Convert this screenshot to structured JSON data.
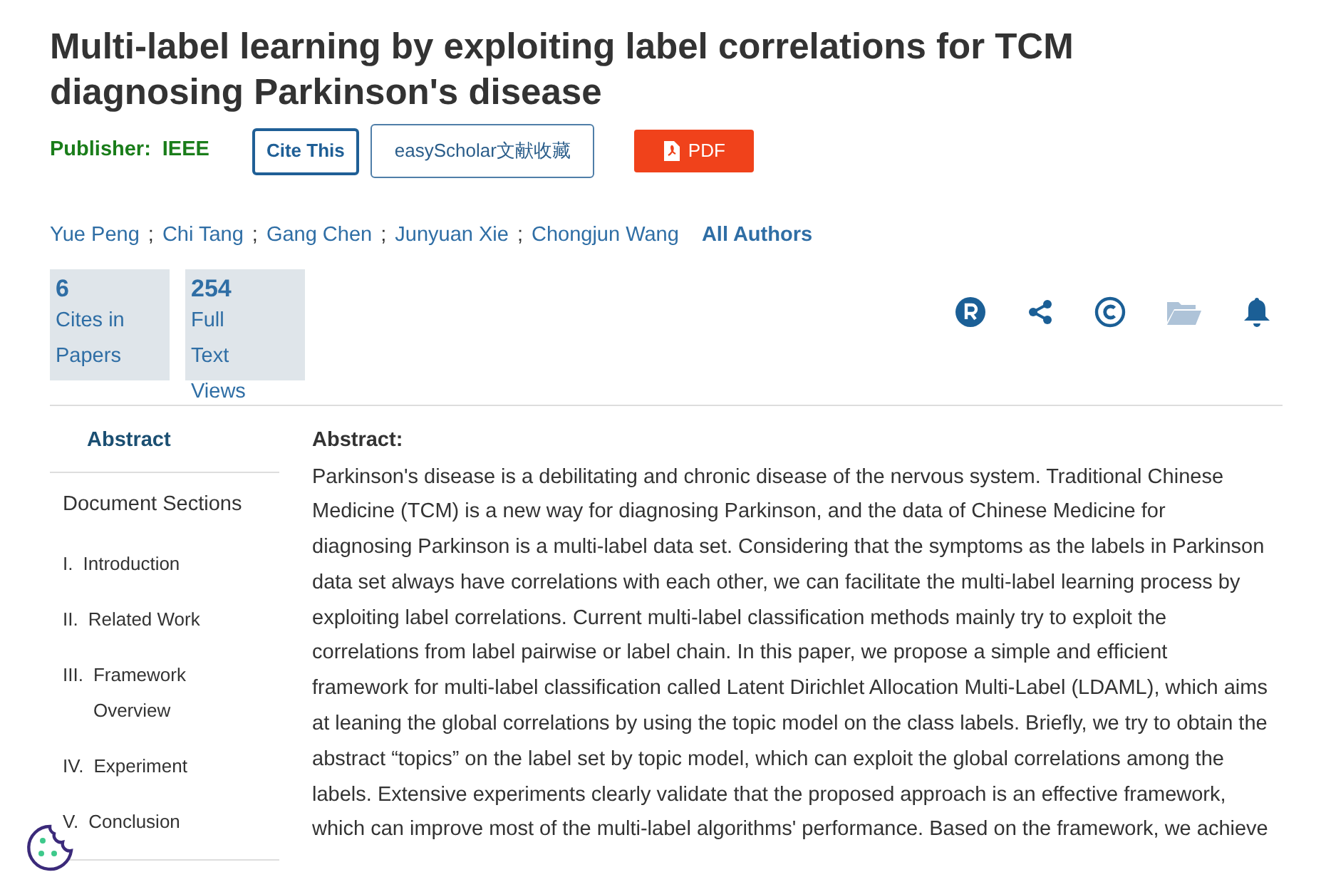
{
  "title": "Multi-label learning by exploiting label correlations for TCM diagnosing Parkinson's disease",
  "publisher": {
    "label": "Publisher:",
    "value": "IEEE"
  },
  "buttons": [
    {
      "kind": "outline-bold",
      "label": "Cite This"
    },
    {
      "kind": "outline",
      "label": "easyScholar文献收藏"
    },
    {
      "kind": "pdf",
      "label": "PDF"
    }
  ],
  "authors": [
    "Yue Peng",
    "Chi Tang",
    "Gang Chen",
    "Junyuan Xie",
    "Chongjun Wang"
  ],
  "authors_separator": ";",
  "all_authors": "All Authors",
  "metrics": [
    {
      "count": "6",
      "label": "Cites in Papers"
    },
    {
      "count": "254",
      "label": "Full Text Views"
    }
  ],
  "actions": [
    {
      "kind": "registered"
    },
    {
      "kind": "share"
    },
    {
      "kind": "copyright"
    },
    {
      "kind": "folder",
      "disabled": true
    },
    {
      "kind": "bell"
    }
  ],
  "sidebar": {
    "tab": {
      "label": "Abstract",
      "selected": true
    },
    "heading": "Document Sections",
    "sections": [
      {
        "number": "I.",
        "title": "Introduction"
      },
      {
        "number": "II.",
        "title": "Related Work"
      },
      {
        "number": "III.",
        "title": "Framework Overview"
      },
      {
        "number": "IV.",
        "title": "Experiment"
      },
      {
        "number": "V.",
        "title": "Conclusion"
      }
    ]
  },
  "abstract": {
    "heading": "Abstract:",
    "text": "Parkinson's disease is a debilitating and chronic disease of the nervous system. Traditional Chinese Medicine (TCM) is a new way for diagnosing Parkinson, and the data of Chinese Medicine for diagnosing Parkinson is a multi-label data set. Considering that the symptoms as the labels in Parkinson data set always have correlations with each other, we can facilitate the multi-label learning process by exploiting label correlations. Current multi-label classification methods mainly try to exploit the correlations from label pairwise or label chain. In this paper, we propose a simple and efficient framework for multi-label classification called Latent Dirichlet Allocation Multi-Label (LDAML), which aims at leaning the global correlations by using the topic model on the class labels. Briefly, we try to obtain the abstract “topics” on the label set by topic model, which can exploit the global correlations among the labels. Extensive experiments clearly validate that the proposed approach is an effective framework, which can improve most of the multi-label algorithms' performance. Based on the framework, we achieve"
  }
}
